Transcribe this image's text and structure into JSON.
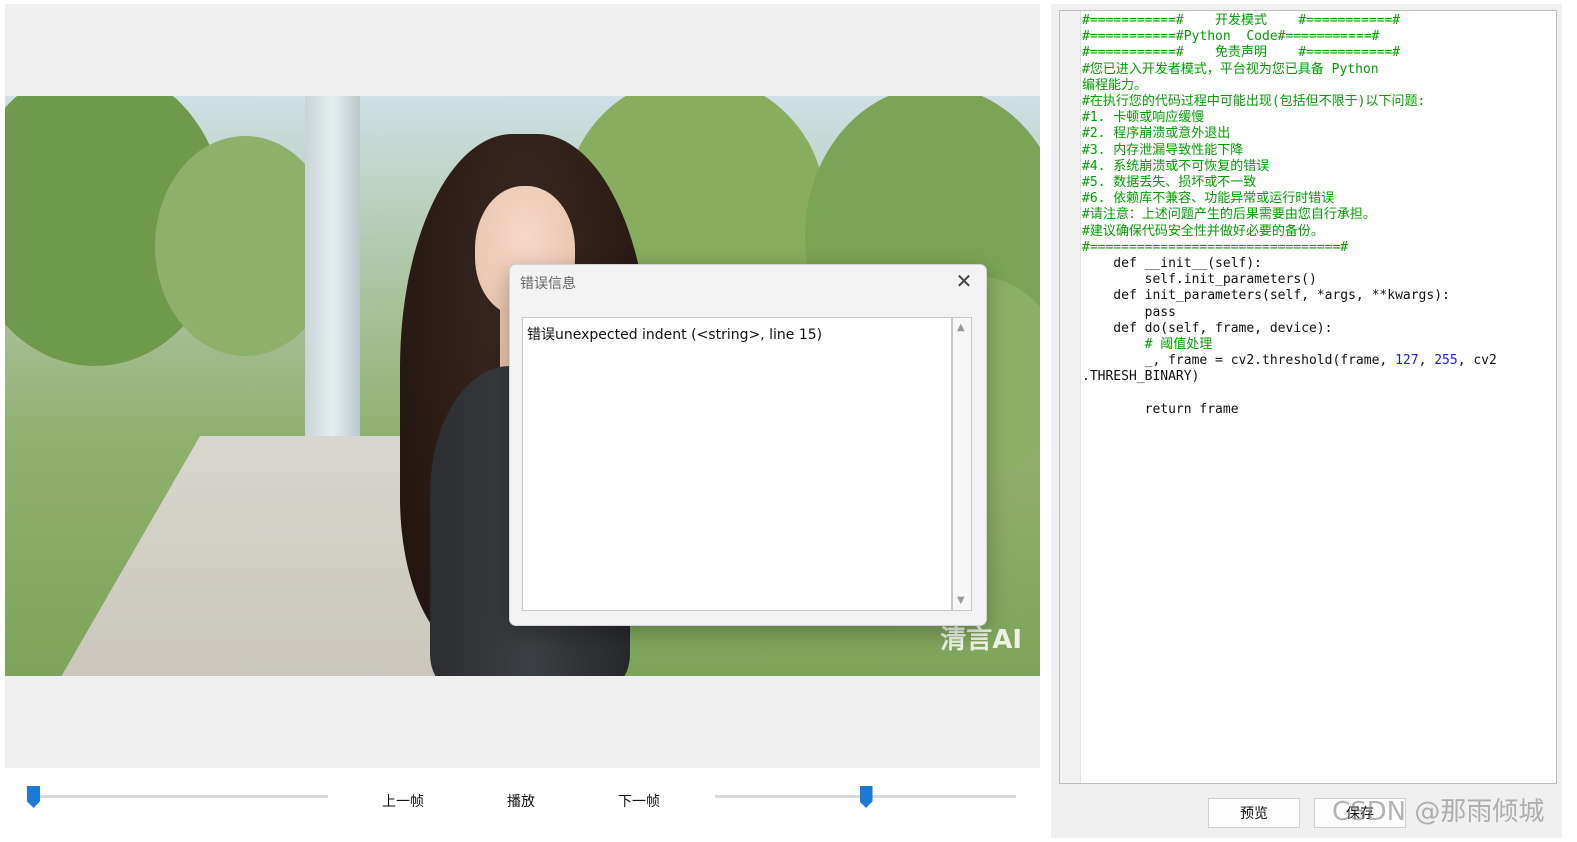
{
  "controls": {
    "prev_frame": "上一帧",
    "play": "播放",
    "next_frame": "下一帧",
    "left_slider_value": 0.0,
    "right_slider_value": 0.5
  },
  "video": {
    "watermark": "清言AI"
  },
  "error_dialog": {
    "title": "错误信息",
    "message": "错误unexpected indent (<string>, line 15)"
  },
  "code_editor": {
    "lines": [
      "#===========#    开发模式    #===========#",
      "#===========#Python  Code#===========#",
      "#===========#    免责声明    #===========#",
      "#您已进入开发者模式，平台视为您已具备 Python",
      "编程能力。",
      "#在执行您的代码过程中可能出现(包括但不限于)以下问题:",
      "#1. 卡顿或响应缓慢",
      "#2. 程序崩溃或意外退出",
      "#3. 内存泄漏导致性能下降",
      "#4. 系统崩溃或不可恢复的错误",
      "#5. 数据丢失、损坏或不一致",
      "#6. 依赖库不兼容、功能异常或运行时错误",
      "#请注意：上述问题产生的后果需要由您自行承担。",
      "#建议确保代码安全性并做好必要的备份。",
      "#================================#",
      "    def __init__(self):",
      "        self.init_parameters()",
      "    def init_parameters(self, *args, **kwargs):",
      "        pass",
      "    def do(self, frame, device):",
      "        # 阈值处理",
      "        _, frame = cv2.threshold(frame, 127, 255, cv2",
      ".THRESH_BINARY)",
      "",
      "        return frame"
    ],
    "preview_button": "预览",
    "save_button": "保存"
  },
  "watermark_text": "CSDN @那雨倾城",
  "colors": {
    "comment": "#00a000",
    "number": "#2020d0",
    "slider_thumb": "#1e78d6"
  }
}
